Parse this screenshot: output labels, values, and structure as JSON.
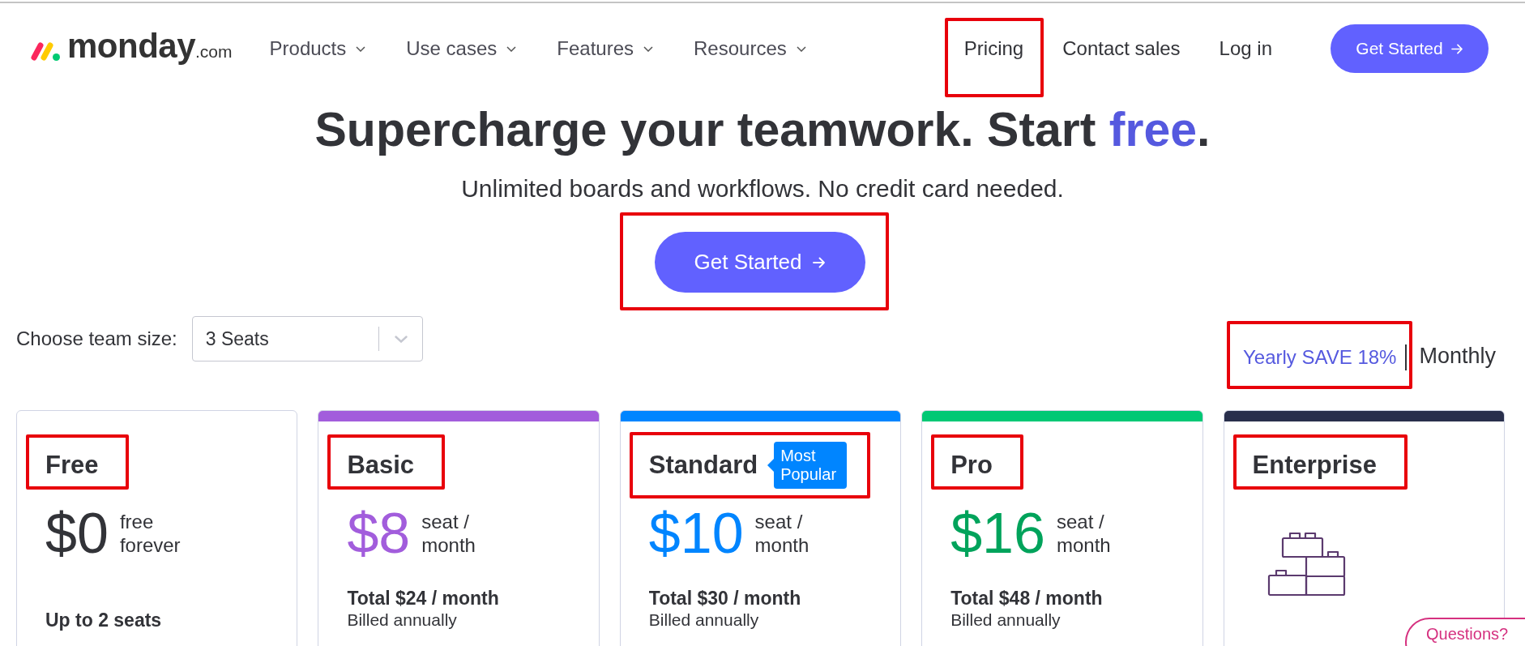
{
  "header": {
    "logo": {
      "name": "monday",
      "suffix": ".com"
    },
    "menus": [
      {
        "label": "Products"
      },
      {
        "label": "Use cases"
      },
      {
        "label": "Features"
      },
      {
        "label": "Resources"
      }
    ],
    "links": [
      {
        "label": "Pricing",
        "highlighted": true
      },
      {
        "label": "Contact sales",
        "highlighted": false
      },
      {
        "label": "Log in",
        "highlighted": false
      }
    ],
    "cta": {
      "label": "Get Started"
    }
  },
  "hero": {
    "title": [
      {
        "text": "Supercharge your teamwork. Start ",
        "accent": false
      },
      {
        "text": "free",
        "accent": true
      },
      {
        "text": ".",
        "accent": false
      }
    ],
    "subtitle": "Unlimited boards and workflows. No credit card needed.",
    "cta": {
      "label": "Get Started",
      "highlighted": true
    }
  },
  "team_size": {
    "label": "Choose team size:",
    "value": "3 Seats"
  },
  "billing": [
    {
      "label": "Yearly SAVE 18%",
      "selected": true,
      "highlighted": true
    },
    {
      "label": "Monthly",
      "selected": false,
      "highlighted": false
    }
  ],
  "plans": [
    {
      "kind": "free",
      "name": "Free",
      "highlighted": true,
      "price": {
        "text": "$0",
        "color": "#323338"
      },
      "period": "free forever",
      "seats_note": "Up to 2 seats"
    },
    {
      "kind": "paid",
      "name": "Basic",
      "highlighted": true,
      "color": "#a25ddc",
      "price": {
        "text": "$8",
        "color": "#a25ddc"
      },
      "period": "seat / month",
      "total": "Total $24 / month",
      "billing": "Billed annually"
    },
    {
      "kind": "paid",
      "name": "Standard",
      "highlighted": true,
      "color": "#0085ff",
      "badge": "Most Popular",
      "price": {
        "text": "$10",
        "color": "#0085ff"
      },
      "period": "seat / month",
      "total": "Total $30 / month",
      "billing": "Billed annually"
    },
    {
      "kind": "paid",
      "name": "Pro",
      "highlighted": true,
      "color": "#00c875",
      "price": {
        "text": "$16",
        "color": "#00a35b"
      },
      "period": "seat / month",
      "total": "Total $48 / month",
      "billing": "Billed annually"
    },
    {
      "kind": "enterprise",
      "name": "Enterprise",
      "highlighted": true,
      "color": "#292f4c"
    }
  ],
  "chat_button": {
    "label": "Questions?"
  }
}
